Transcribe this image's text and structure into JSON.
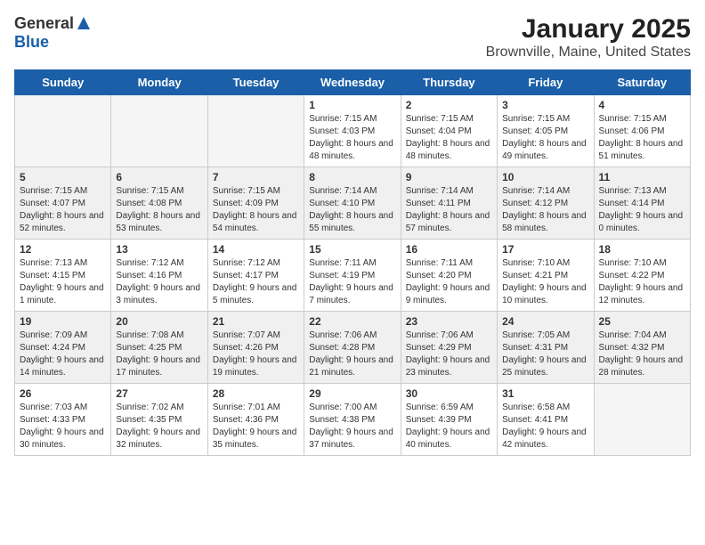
{
  "logo": {
    "general": "General",
    "blue": "Blue"
  },
  "title": "January 2025",
  "location": "Brownville, Maine, United States",
  "weekdays": [
    "Sunday",
    "Monday",
    "Tuesday",
    "Wednesday",
    "Thursday",
    "Friday",
    "Saturday"
  ],
  "weeks": [
    [
      {
        "day": "",
        "info": ""
      },
      {
        "day": "",
        "info": ""
      },
      {
        "day": "",
        "info": ""
      },
      {
        "day": "1",
        "info": "Sunrise: 7:15 AM\nSunset: 4:03 PM\nDaylight: 8 hours and 48 minutes."
      },
      {
        "day": "2",
        "info": "Sunrise: 7:15 AM\nSunset: 4:04 PM\nDaylight: 8 hours and 48 minutes."
      },
      {
        "day": "3",
        "info": "Sunrise: 7:15 AM\nSunset: 4:05 PM\nDaylight: 8 hours and 49 minutes."
      },
      {
        "day": "4",
        "info": "Sunrise: 7:15 AM\nSunset: 4:06 PM\nDaylight: 8 hours and 51 minutes."
      }
    ],
    [
      {
        "day": "5",
        "info": "Sunrise: 7:15 AM\nSunset: 4:07 PM\nDaylight: 8 hours and 52 minutes."
      },
      {
        "day": "6",
        "info": "Sunrise: 7:15 AM\nSunset: 4:08 PM\nDaylight: 8 hours and 53 minutes."
      },
      {
        "day": "7",
        "info": "Sunrise: 7:15 AM\nSunset: 4:09 PM\nDaylight: 8 hours and 54 minutes."
      },
      {
        "day": "8",
        "info": "Sunrise: 7:14 AM\nSunset: 4:10 PM\nDaylight: 8 hours and 55 minutes."
      },
      {
        "day": "9",
        "info": "Sunrise: 7:14 AM\nSunset: 4:11 PM\nDaylight: 8 hours and 57 minutes."
      },
      {
        "day": "10",
        "info": "Sunrise: 7:14 AM\nSunset: 4:12 PM\nDaylight: 8 hours and 58 minutes."
      },
      {
        "day": "11",
        "info": "Sunrise: 7:13 AM\nSunset: 4:14 PM\nDaylight: 9 hours and 0 minutes."
      }
    ],
    [
      {
        "day": "12",
        "info": "Sunrise: 7:13 AM\nSunset: 4:15 PM\nDaylight: 9 hours and 1 minute."
      },
      {
        "day": "13",
        "info": "Sunrise: 7:12 AM\nSunset: 4:16 PM\nDaylight: 9 hours and 3 minutes."
      },
      {
        "day": "14",
        "info": "Sunrise: 7:12 AM\nSunset: 4:17 PM\nDaylight: 9 hours and 5 minutes."
      },
      {
        "day": "15",
        "info": "Sunrise: 7:11 AM\nSunset: 4:19 PM\nDaylight: 9 hours and 7 minutes."
      },
      {
        "day": "16",
        "info": "Sunrise: 7:11 AM\nSunset: 4:20 PM\nDaylight: 9 hours and 9 minutes."
      },
      {
        "day": "17",
        "info": "Sunrise: 7:10 AM\nSunset: 4:21 PM\nDaylight: 9 hours and 10 minutes."
      },
      {
        "day": "18",
        "info": "Sunrise: 7:10 AM\nSunset: 4:22 PM\nDaylight: 9 hours and 12 minutes."
      }
    ],
    [
      {
        "day": "19",
        "info": "Sunrise: 7:09 AM\nSunset: 4:24 PM\nDaylight: 9 hours and 14 minutes."
      },
      {
        "day": "20",
        "info": "Sunrise: 7:08 AM\nSunset: 4:25 PM\nDaylight: 9 hours and 17 minutes."
      },
      {
        "day": "21",
        "info": "Sunrise: 7:07 AM\nSunset: 4:26 PM\nDaylight: 9 hours and 19 minutes."
      },
      {
        "day": "22",
        "info": "Sunrise: 7:06 AM\nSunset: 4:28 PM\nDaylight: 9 hours and 21 minutes."
      },
      {
        "day": "23",
        "info": "Sunrise: 7:06 AM\nSunset: 4:29 PM\nDaylight: 9 hours and 23 minutes."
      },
      {
        "day": "24",
        "info": "Sunrise: 7:05 AM\nSunset: 4:31 PM\nDaylight: 9 hours and 25 minutes."
      },
      {
        "day": "25",
        "info": "Sunrise: 7:04 AM\nSunset: 4:32 PM\nDaylight: 9 hours and 28 minutes."
      }
    ],
    [
      {
        "day": "26",
        "info": "Sunrise: 7:03 AM\nSunset: 4:33 PM\nDaylight: 9 hours and 30 minutes."
      },
      {
        "day": "27",
        "info": "Sunrise: 7:02 AM\nSunset: 4:35 PM\nDaylight: 9 hours and 32 minutes."
      },
      {
        "day": "28",
        "info": "Sunrise: 7:01 AM\nSunset: 4:36 PM\nDaylight: 9 hours and 35 minutes."
      },
      {
        "day": "29",
        "info": "Sunrise: 7:00 AM\nSunset: 4:38 PM\nDaylight: 9 hours and 37 minutes."
      },
      {
        "day": "30",
        "info": "Sunrise: 6:59 AM\nSunset: 4:39 PM\nDaylight: 9 hours and 40 minutes."
      },
      {
        "day": "31",
        "info": "Sunrise: 6:58 AM\nSunset: 4:41 PM\nDaylight: 9 hours and 42 minutes."
      },
      {
        "day": "",
        "info": ""
      }
    ]
  ]
}
